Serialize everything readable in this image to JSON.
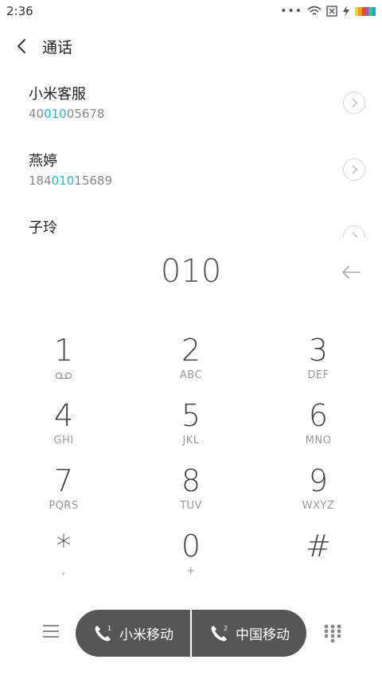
{
  "status_bar": {
    "time": "2:36",
    "dots": "•••"
  },
  "header": {
    "title": "通话"
  },
  "contacts": [
    {
      "name": "小米客服",
      "number_pre": "40",
      "number_hl": "010",
      "number_post": "05678"
    },
    {
      "name": "燕婷",
      "number_pre": "184",
      "number_hl": "010",
      "number_post": "15689"
    },
    {
      "name": "子玲",
      "number_pre": "",
      "number_hl": "",
      "number_post": ""
    }
  ],
  "dialer": {
    "input": "010"
  },
  "keypad": [
    {
      "digit": "1",
      "letters": ""
    },
    {
      "digit": "2",
      "letters": "ABC"
    },
    {
      "digit": "3",
      "letters": "DEF"
    },
    {
      "digit": "4",
      "letters": "GHI"
    },
    {
      "digit": "5",
      "letters": "JKL"
    },
    {
      "digit": "6",
      "letters": "MNO"
    },
    {
      "digit": "7",
      "letters": "PQRS"
    },
    {
      "digit": "8",
      "letters": "TUV"
    },
    {
      "digit": "9",
      "letters": "WXYZ"
    },
    {
      "digit": "*",
      "letters": ","
    },
    {
      "digit": "0",
      "letters": "+"
    },
    {
      "digit": "#",
      "letters": ""
    }
  ],
  "call_buttons": [
    {
      "label": "小米移动",
      "sim": "1"
    },
    {
      "label": "中国移动",
      "sim": "2"
    }
  ],
  "colors": {
    "highlight": "#25b8d8",
    "call_bar": "#565656"
  },
  "icons": {
    "back": "back-arrow-icon",
    "wifi": "wifi-icon",
    "no_sim": "sim-x-icon",
    "charging": "charging-icon",
    "battery": "battery-icon",
    "info": "chevron-right-icon",
    "backspace": "backspace-arrow-icon",
    "voicemail": "voicemail-icon",
    "menu": "menu-icon",
    "phone": "phone-icon",
    "dialpad": "dialpad-grid-icon"
  }
}
